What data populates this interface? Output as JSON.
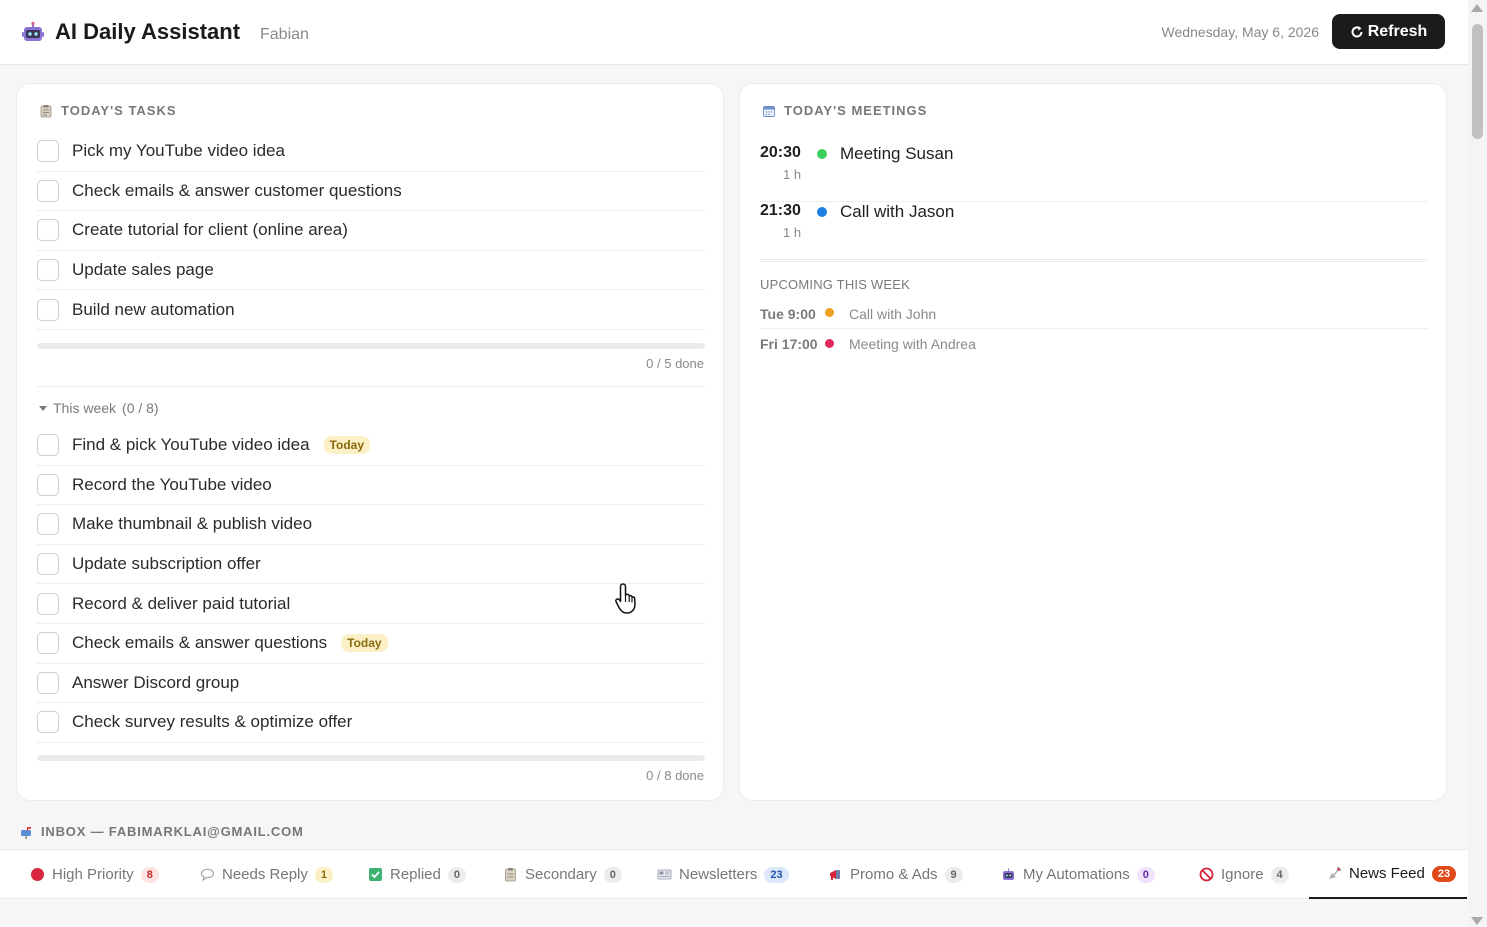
{
  "header": {
    "app_title": "AI Daily Assistant",
    "user_name": "Fabian",
    "date": "Wednesday, May 6, 2026",
    "refresh_label": "Refresh",
    "refresh_icon": "refresh-icon"
  },
  "tasks": {
    "heading": "TODAY'S TASKS",
    "today_items": [
      {
        "label": "Pick my YouTube video idea"
      },
      {
        "label": "Check emails & answer customer questions"
      },
      {
        "label": "Create tutorial for client (online area)"
      },
      {
        "label": "Update sales page"
      },
      {
        "label": "Build new automation"
      }
    ],
    "today_progress": 0.0,
    "today_done": "0 / 5 done",
    "week_toggle": "This week",
    "week_count": "(0 / 8)",
    "week_items": [
      {
        "label": "Find & pick YouTube video idea",
        "badge": "Today"
      },
      {
        "label": "Record the YouTube video",
        "badge": ""
      },
      {
        "label": "Make thumbnail & publish video",
        "badge": ""
      },
      {
        "label": "Update subscription offer",
        "badge": ""
      },
      {
        "label": "Record & deliver paid tutorial",
        "badge": ""
      },
      {
        "label": "Check emails & answer questions",
        "badge": "Today"
      },
      {
        "label": "Answer Discord group",
        "badge": ""
      },
      {
        "label": "Check survey results & optimize offer",
        "badge": ""
      }
    ],
    "week_progress": 0.0,
    "week_done": "0 / 8 done"
  },
  "meetings": {
    "heading": "TODAY'S MEETINGS",
    "today": [
      {
        "time": "20:30",
        "duration": "1 h",
        "title": "Meeting Susan",
        "color": "#3ecf5a"
      },
      {
        "time": "21:30",
        "duration": "1 h",
        "title": "Call with Jason",
        "color": "#1e7fe0"
      }
    ],
    "upcoming_label": "UPCOMING THIS WEEK",
    "upcoming": [
      {
        "time": "Tue 9:00",
        "title": "Call with John",
        "color": "#f0a020"
      },
      {
        "time": "Fri 17:00",
        "title": "Meeting with Andrea",
        "color": "#e0285a"
      }
    ]
  },
  "inbox": {
    "heading": "INBOX — FABIMARKLAI@GMAIL.COM",
    "tabs": [
      {
        "label": "High Priority",
        "count": "8",
        "icon": "red-circle-icon",
        "count_bg": "#fde3e3",
        "count_color": "#c62828"
      },
      {
        "label": "Needs Reply",
        "count": "1",
        "icon": "speech-bubble-icon",
        "count_bg": "#fbf0c6",
        "count_color": "#8a6b10"
      },
      {
        "label": "Replied",
        "count": "0",
        "icon": "check-box-icon",
        "count_bg": "#ececec",
        "count_color": "#666666"
      },
      {
        "label": "Secondary",
        "count": "0",
        "icon": "clipboard-icon",
        "count_bg": "#ececec",
        "count_color": "#666666"
      },
      {
        "label": "Newsletters",
        "count": "23",
        "icon": "newspaper-icon",
        "count_bg": "#dde8fb",
        "count_color": "#2456a8"
      },
      {
        "label": "Promo & Ads",
        "count": "9",
        "icon": "megaphone-icon",
        "count_bg": "#ececec",
        "count_color": "#666666"
      },
      {
        "label": "My Automations",
        "count": "0",
        "icon": "robot-icon",
        "count_bg": "#efe3fb",
        "count_color": "#6a2aa8"
      },
      {
        "label": "Ignore",
        "count": "4",
        "icon": "no-entry-icon",
        "count_bg": "#ececec",
        "count_color": "#666666"
      },
      {
        "label": "News Feed",
        "count": "23",
        "icon": "satellite-icon",
        "count_bg": "#e04a1a",
        "count_color": "#ffffff"
      }
    ],
    "active_tab": "News Feed"
  }
}
